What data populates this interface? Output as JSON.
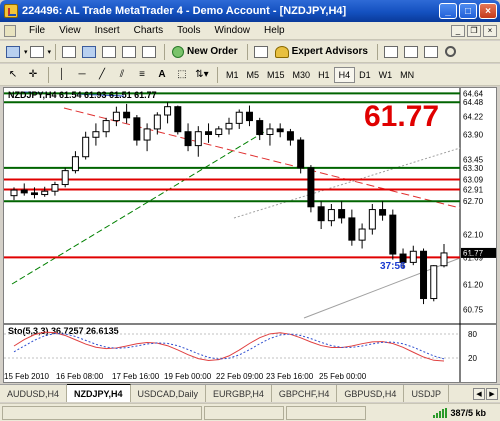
{
  "window": {
    "title": "224496: AL Trade MetaTrader 4 - Demo Account - [NZDJPY,H4]"
  },
  "menu": [
    "File",
    "View",
    "Insert",
    "Charts",
    "Tools",
    "Window",
    "Help"
  ],
  "toolbar": {
    "new_order": "New Order",
    "expert_advisors": "Expert Advisors"
  },
  "timeframes": [
    "M1",
    "M5",
    "M15",
    "M30",
    "H1",
    "H4",
    "D1",
    "W1",
    "MN"
  ],
  "active_timeframe": "H4",
  "chart": {
    "header": "NZDJPY,H4  61.54 61.93 61.51 61.77",
    "big_price": "61.77",
    "countdown": "37:56",
    "price_axis": [
      "64.64",
      "64.48",
      "64.22",
      "63.90",
      "63.45",
      "63.30",
      "63.09",
      "62.91",
      "62.70",
      "62.10",
      "61.77",
      "61.69",
      "61.20",
      "60.75"
    ],
    "current_price": "61.77",
    "time_axis": [
      "15 Feb 2010",
      "16 Feb 08:00",
      "17 Feb 16:00",
      "19 Feb 00:00",
      "22 Feb 09:00",
      "23 Feb 16:00",
      "25 Feb 00:00"
    ],
    "stoch_header": "Sto(5,3,3) 36.7257 26.6135",
    "stoch_axis": [
      "80",
      "20"
    ],
    "colors": {
      "bull": "#ffffff",
      "bear": "#000000",
      "line_red": "#e00000",
      "line_green": "#006400",
      "stoch_main": "#e04040",
      "stoch_signal": "#3050d0"
    }
  },
  "chart_data": {
    "type": "line",
    "title": "NZDJPY,H4",
    "ohlc_current": {
      "open": 61.54,
      "high": 61.93,
      "low": 61.51,
      "close": 61.77
    },
    "ylim": [
      60.6,
      64.7
    ],
    "candles": [
      [
        62.8,
        62.95,
        62.72,
        62.9
      ],
      [
        62.9,
        63.02,
        62.8,
        62.85
      ],
      [
        62.85,
        62.95,
        62.75,
        62.82
      ],
      [
        62.82,
        62.96,
        62.78,
        62.88
      ],
      [
        62.88,
        63.05,
        62.8,
        63.0
      ],
      [
        63.0,
        63.3,
        62.95,
        63.25
      ],
      [
        63.25,
        63.6,
        63.2,
        63.5
      ],
      [
        63.5,
        63.95,
        63.45,
        63.85
      ],
      [
        63.85,
        64.1,
        63.7,
        63.95
      ],
      [
        63.95,
        64.2,
        63.85,
        64.15
      ],
      [
        64.15,
        64.4,
        64.05,
        64.3
      ],
      [
        64.3,
        64.45,
        64.1,
        64.2
      ],
      [
        64.2,
        64.25,
        63.7,
        63.8
      ],
      [
        63.8,
        64.1,
        63.6,
        64.0
      ],
      [
        64.0,
        64.3,
        63.9,
        64.25
      ],
      [
        64.25,
        64.48,
        64.1,
        64.4
      ],
      [
        64.4,
        64.42,
        63.9,
        63.95
      ],
      [
        63.95,
        64.1,
        63.6,
        63.7
      ],
      [
        63.7,
        64.05,
        63.5,
        63.95
      ],
      [
        63.95,
        64.1,
        63.75,
        63.9
      ],
      [
        63.9,
        64.05,
        63.85,
        64.0
      ],
      [
        64.0,
        64.2,
        63.9,
        64.1
      ],
      [
        64.1,
        64.35,
        64.0,
        64.3
      ],
      [
        64.3,
        64.42,
        64.05,
        64.15
      ],
      [
        64.15,
        64.2,
        63.8,
        63.9
      ],
      [
        63.9,
        64.1,
        63.7,
        64.0
      ],
      [
        64.0,
        64.1,
        63.85,
        63.95
      ],
      [
        63.95,
        64.0,
        63.7,
        63.8
      ],
      [
        63.8,
        63.85,
        63.2,
        63.3
      ],
      [
        63.3,
        63.35,
        62.5,
        62.6
      ],
      [
        62.6,
        62.7,
        62.2,
        62.35
      ],
      [
        62.35,
        62.65,
        62.25,
        62.55
      ],
      [
        62.55,
        62.7,
        62.3,
        62.4
      ],
      [
        62.4,
        62.55,
        61.9,
        62.0
      ],
      [
        62.0,
        62.3,
        61.85,
        62.2
      ],
      [
        62.2,
        62.65,
        62.1,
        62.55
      ],
      [
        62.55,
        62.7,
        62.35,
        62.45
      ],
      [
        62.45,
        62.55,
        61.65,
        61.75
      ],
      [
        61.75,
        61.85,
        61.5,
        61.6
      ],
      [
        61.6,
        61.9,
        61.55,
        61.8
      ],
      [
        61.8,
        61.85,
        60.85,
        60.95
      ],
      [
        60.95,
        61.55,
        60.9,
        61.54
      ],
      [
        61.54,
        61.93,
        61.51,
        61.77
      ]
    ],
    "horizontal_levels": {
      "green": [
        64.64,
        64.48,
        63.3,
        62.7
      ],
      "red": [
        63.09,
        62.91,
        61.69
      ]
    },
    "stochastic": {
      "k": 36.7257,
      "d": 26.6135,
      "levels": [
        80,
        20
      ]
    }
  }
}
